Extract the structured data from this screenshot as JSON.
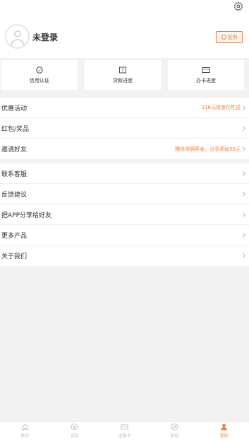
{
  "header": {
    "login_text": "未登录",
    "signin_label": "签到"
  },
  "quick_actions": [
    {
      "label": "信用认证",
      "icon": "credit-icon"
    },
    {
      "label": "贷款进度",
      "icon": "loan-progress-icon"
    },
    {
      "label": "办卡进度",
      "icon": "card-progress-icon"
    }
  ],
  "group1": [
    {
      "label": "优惠活动",
      "extra": "316元现金任性送"
    },
    {
      "label": "红包/奖品",
      "extra": ""
    },
    {
      "label": "邀请好友",
      "extra": "赚佳保佣奖金，分享奖励50元"
    }
  ],
  "group2": [
    {
      "label": "联系客服"
    },
    {
      "label": "反馈建议"
    },
    {
      "label": "把APP分享给好友"
    },
    {
      "label": "更多产品"
    },
    {
      "label": "关于我们"
    }
  ],
  "tabbar": [
    {
      "label": "首页",
      "icon": "home-icon",
      "active": false
    },
    {
      "label": "贷款",
      "icon": "loan-icon",
      "active": false
    },
    {
      "label": "信用卡",
      "icon": "credit-card-icon",
      "active": false
    },
    {
      "label": "发现",
      "icon": "discover-icon",
      "active": false
    },
    {
      "label": "我的",
      "icon": "profile-icon",
      "active": true
    }
  ],
  "colors": {
    "accent": "#f07b3f",
    "background": "#f2f2f2"
  }
}
